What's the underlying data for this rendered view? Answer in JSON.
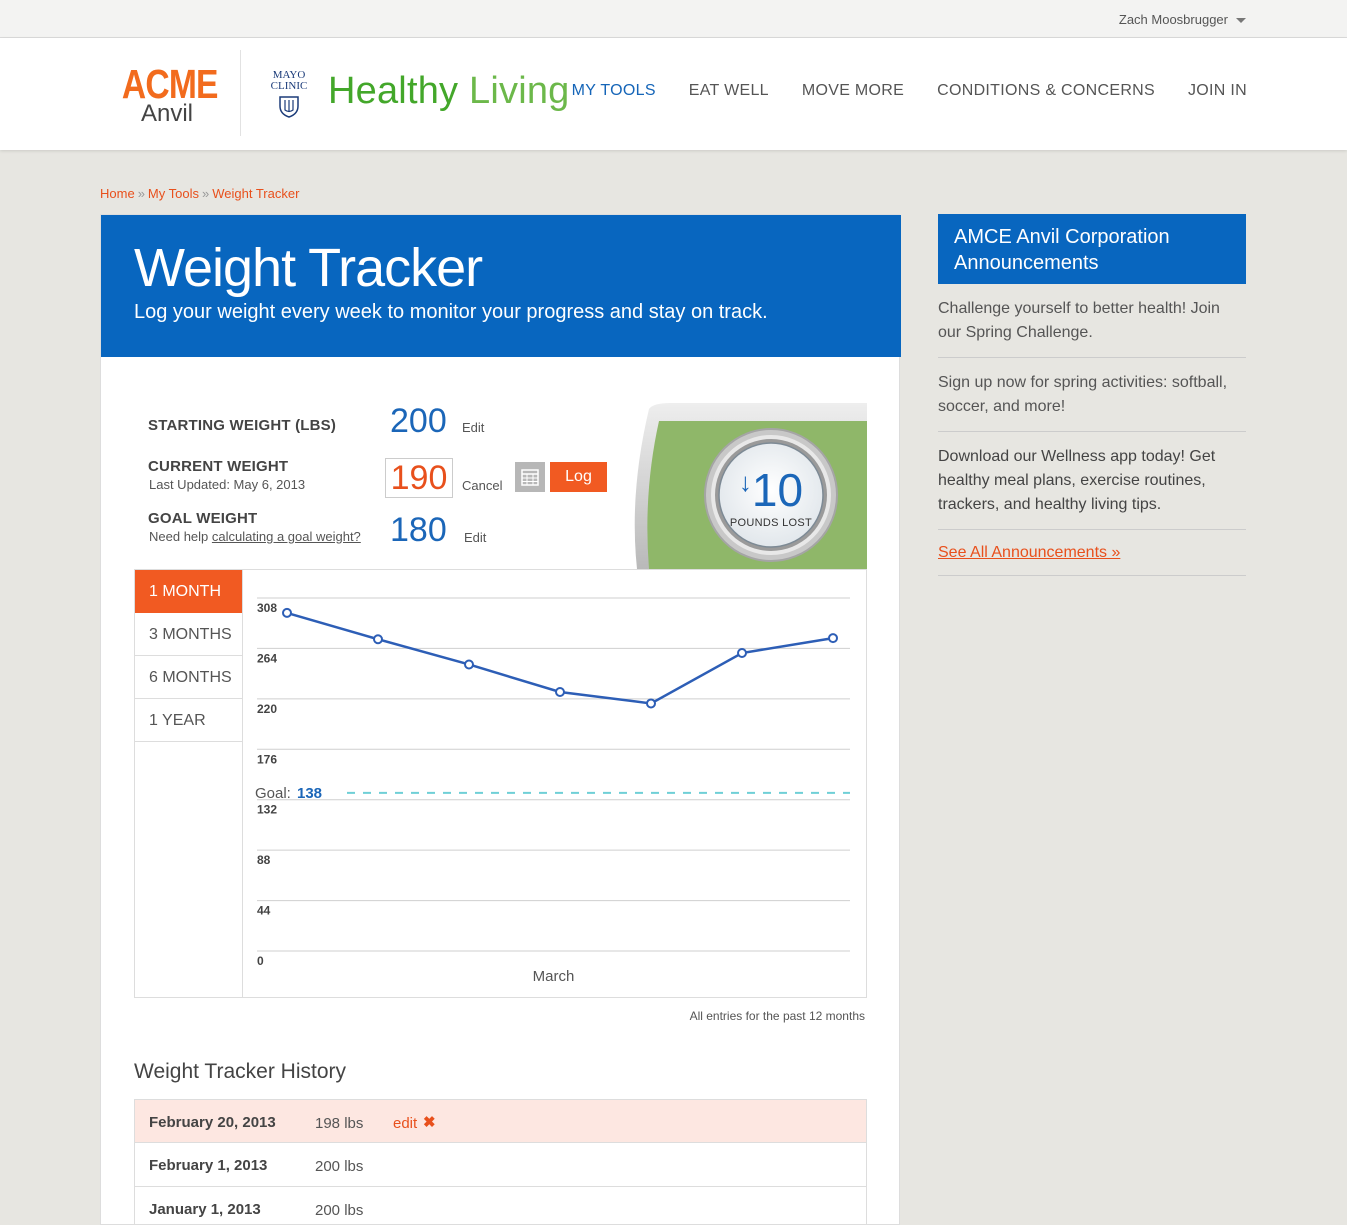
{
  "topbar": {
    "user_name": "Zach Moosbrugger"
  },
  "logo": {
    "acme": "ACME",
    "anvil": "Anvil",
    "mayo_line1": "MAYO",
    "mayo_line2": "CLINIC",
    "healthy": "Healthy",
    "living": "Living"
  },
  "nav": {
    "items": [
      "MY TOOLS",
      "EAT WELL",
      "MOVE MORE",
      "CONDITIONS & CONCERNS",
      "JOIN IN"
    ]
  },
  "breadcrumb": {
    "home": "Home",
    "sep": "»",
    "tools": "My Tools",
    "current": "Weight Tracker"
  },
  "hero": {
    "title": "Weight Tracker",
    "subtitle": "Log your weight every week to monitor your progress and stay on track."
  },
  "weights": {
    "starting_label": "STARTING WEIGHT (LBS)",
    "starting_value": "200",
    "starting_action": "Edit",
    "current_label": "CURRENT WEIGHT",
    "current_updated": "Last Updated: May 6, 2013",
    "current_value": "190",
    "current_action": "Cancel",
    "log_label": "Log",
    "goal_label": "GOAL WEIGHT",
    "goal_help_prefix": "Need help",
    "goal_help_link": "calculating a goal weight?",
    "goal_value": "180",
    "goal_action": "Edit"
  },
  "scale": {
    "arrow": "↓",
    "value": "10",
    "label": "POUNDS LOST"
  },
  "tabs": [
    "1 MONTH",
    "3 MONTHS",
    "6 MONTHS",
    "1 YEAR"
  ],
  "chart_data": {
    "type": "line",
    "x": [
      1,
      2,
      3,
      4,
      5,
      6,
      7
    ],
    "xlabel": "March",
    "ylabel": "",
    "ylim": [
      0,
      308
    ],
    "yticks": [
      308,
      264,
      220,
      176,
      132,
      88,
      44,
      0
    ],
    "series": [
      {
        "values": [
          295,
          272,
          250,
          226,
          216,
          260,
          273
        ]
      }
    ],
    "goal": {
      "label": "Goal:",
      "value": 138
    }
  },
  "entries_note": "All entries for the past 12 months",
  "history": {
    "title": "Weight Tracker History",
    "rows": [
      {
        "date": "February 20, 2013",
        "weight": "198 lbs",
        "edit": "edit"
      },
      {
        "date": "February 1, 2013",
        "weight": "200 lbs"
      },
      {
        "date": "January 1, 2013",
        "weight": "200 lbs"
      }
    ]
  },
  "sidebar": {
    "title": "AMCE Anvil Corporation Announcements",
    "items": [
      "Challenge yourself to better health! Join our Spring Challenge.",
      "Sign up now for spring activities: softball, soccer, and more!",
      "Download our Wellness app today! Get healthy meal plans, exercise routines, trackers, and healthy living tips."
    ],
    "see_all": "See All Announcements »"
  },
  "colors": {
    "brand_blue": "#0866bf",
    "accent_orange": "#f15a22",
    "line_blue": "#2d5eb6",
    "goal_line": "#6fcfd6"
  }
}
